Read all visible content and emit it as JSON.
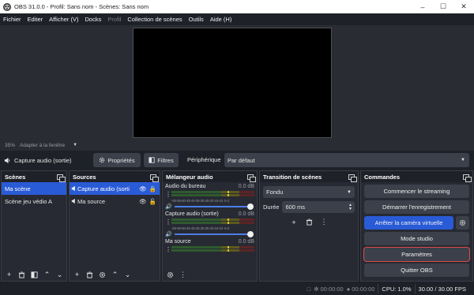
{
  "window": {
    "title": "OBS 31.0.0 - Profil: Sans nom - Scènes: Sans nom"
  },
  "menu": [
    "Fichier",
    "Editer",
    "Afficher (V)",
    "Docks",
    "Profil",
    "Collection de scènes",
    "Outils",
    "Aide (H)"
  ],
  "zoom": {
    "percent": "35%",
    "fit_label": "Adapter à la fenêtre"
  },
  "source_bar": {
    "source_name": "Capture audio (sortie)",
    "properties_label": "Propriétés",
    "filters_label": "Filtres",
    "device_label": "Périphérique",
    "device_value": "Par défaut"
  },
  "scenes": {
    "title": "Scènes",
    "items": [
      "Ma scène",
      "Scène jeu védio A"
    ]
  },
  "sources": {
    "title": "Sources",
    "items": [
      "Capture audio (sorti",
      "Ma source"
    ]
  },
  "mixer": {
    "title": "Mélangeur audio",
    "ticks": "-60-55-50-45-40-35-30-25-20-15-10 -5 0",
    "channels": [
      {
        "name": "Audio du bureau",
        "db": "0.0 dB"
      },
      {
        "name": "Capture audio (sortie)",
        "db": "0.0 dB"
      },
      {
        "name": "Ma source",
        "db": "0.0 dB"
      }
    ]
  },
  "transitions": {
    "title": "Transition de scènes",
    "selected": "Fondu",
    "duration_label": "Durée",
    "duration_value": "600 ms"
  },
  "commands": {
    "title": "Commandes",
    "start_streaming": "Commencer le streaming",
    "start_recording": "Démarrer l'enregistrement",
    "stop_virtual_cam": "Arrêter la caméra virtuelle",
    "studio_mode": "Mode studio",
    "settings": "Paramètres",
    "quit": "Quitter OBS"
  },
  "status": {
    "stream_time": "00:00:00",
    "record_time": "00:00:00",
    "cpu": "CPU: 1.0%",
    "fps": "30.00 / 30.00 FPS"
  }
}
